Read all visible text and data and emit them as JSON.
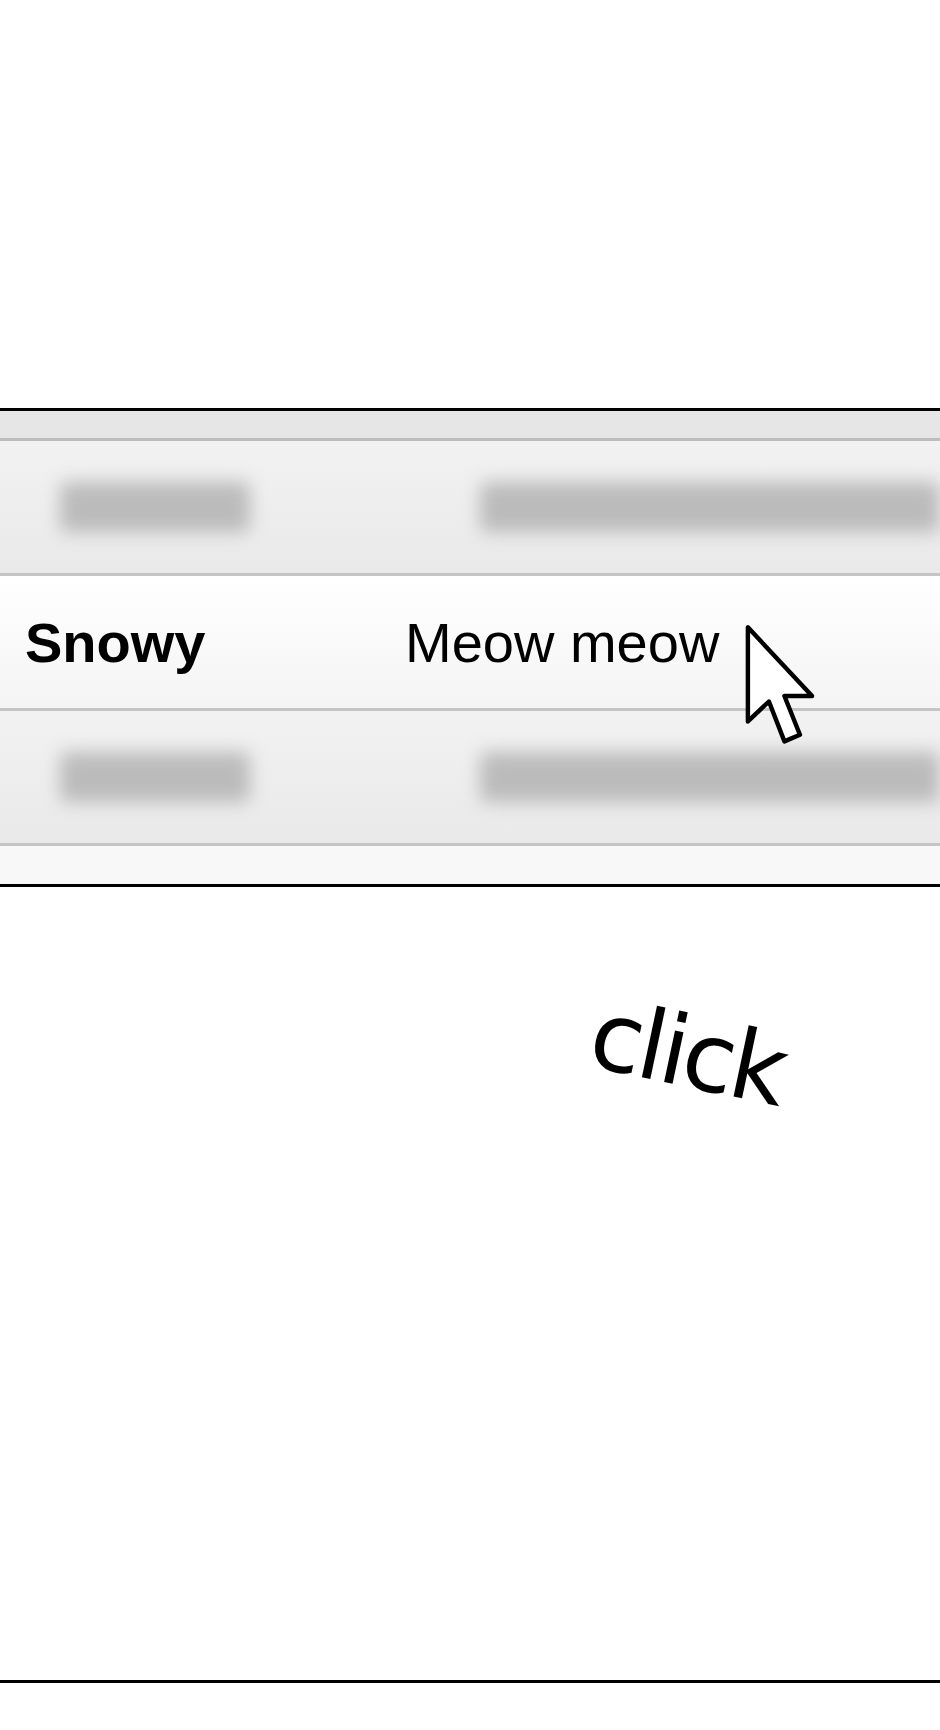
{
  "list": {
    "rows": [
      {
        "kind": "blurred",
        "selected": false
      },
      {
        "kind": "clear",
        "name": "Snowy",
        "message": "Meow meow",
        "selected": true
      },
      {
        "kind": "blurred",
        "selected": false
      }
    ]
  },
  "caption": "click"
}
